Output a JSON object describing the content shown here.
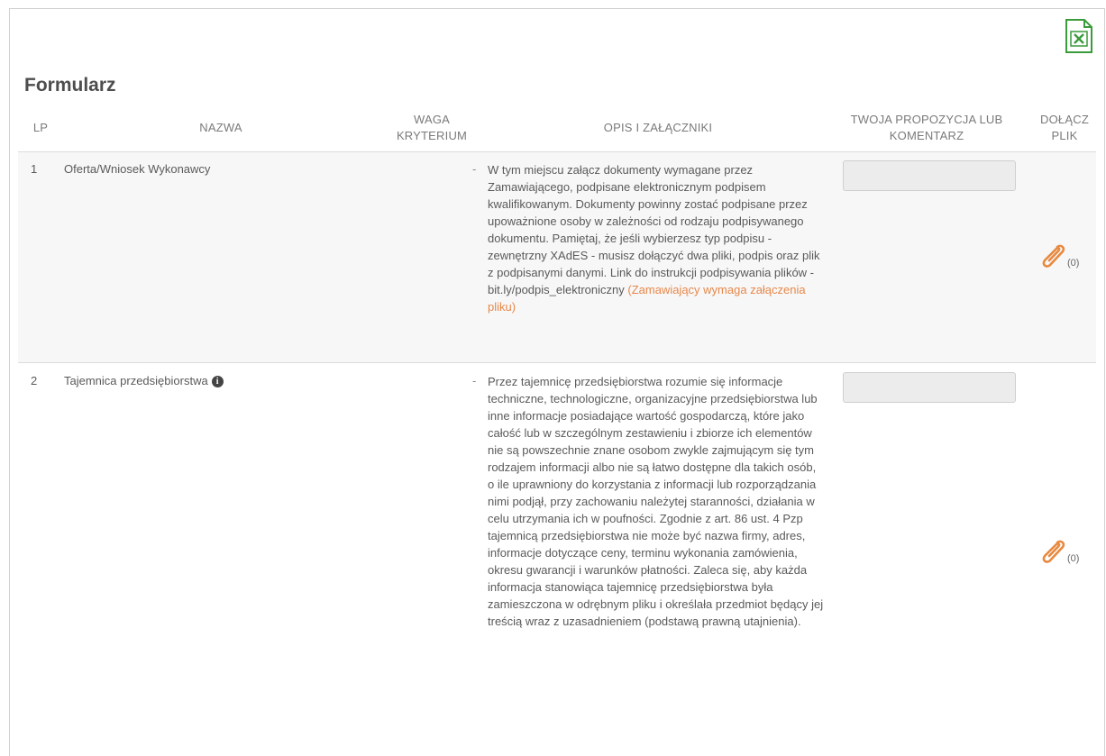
{
  "export": {
    "icon": "excel-export-icon",
    "color": "#3a9b3a"
  },
  "title": "Formularz",
  "columns": {
    "lp": "LP",
    "nazwa": "NAZWA",
    "waga": "WAGA KRYTERIUM",
    "opis": "OPIS I ZAŁĄCZNIKI",
    "propozycja": "TWOJA PROPOZYCJA LUB KOMENTARZ",
    "plik": "DOŁĄCZ PLIK"
  },
  "rows": [
    {
      "lp": "1",
      "nazwa": "Oferta/Wniosek Wykonawcy",
      "waga": "-",
      "opis": "W tym miejscu załącz dokumenty wymagane przez Zamawiającego, podpisane elektronicznym podpisem kwalifikowanym. Dokumenty powinny zostać podpisane przez upoważnione osoby w zależności od rodzaju podpisywanego dokumentu. Pamiętaj, że jeśli wybierzesz typ podpisu - zewnętrzny XAdES - musisz dołączyć dwa pliki, podpis oraz plik z podpisanymi danymi. Link do instrukcji podpisywania plików - bit.ly/podpis_elektroniczny",
      "note": "(Zamawiający wymaga załączenia pliku)",
      "comment": "",
      "attach_count": "(0)"
    },
    {
      "lp": "2",
      "nazwa": "Tajemnica przedsiębiorstwa",
      "waga": "-",
      "opis": "Przez tajemnicę przedsiębiorstwa rozumie się informacje techniczne, technologiczne, organizacyjne przedsiębiorstwa lub inne informacje posiadające wartość gospodarczą, które jako całość lub w szczególnym zestawieniu i zbiorze ich elementów nie są powszechnie znane osobom zwykle zajmującym się tym rodzajem informacji albo nie są łatwo dostępne dla takich osób, o ile uprawniony do korzystania z informacji lub rozporządzania nimi podjął, przy zachowaniu należytej staranności, działania w celu utrzymania ich w poufności. Zgodnie z art. 86 ust. 4 Pzp tajemnicą przedsiębiorstwa nie może być nazwa firmy, adres, informacje dotyczące ceny, terminu wykonania zamówienia, okresu gwarancji i warunków płatności. Zaleca się, aby każda informacja stanowiąca tajemnicę przedsiębiorstwa była zamieszczona w odrębnym pliku i określała przedmiot będący jej treścią wraz z uzasadnieniem (podstawą prawną utajnienia).",
      "comment": "",
      "attach_count": "(0)",
      "info_icon": "i"
    }
  ],
  "colors": {
    "attach": "#e8893f",
    "note": "#e7884a"
  }
}
